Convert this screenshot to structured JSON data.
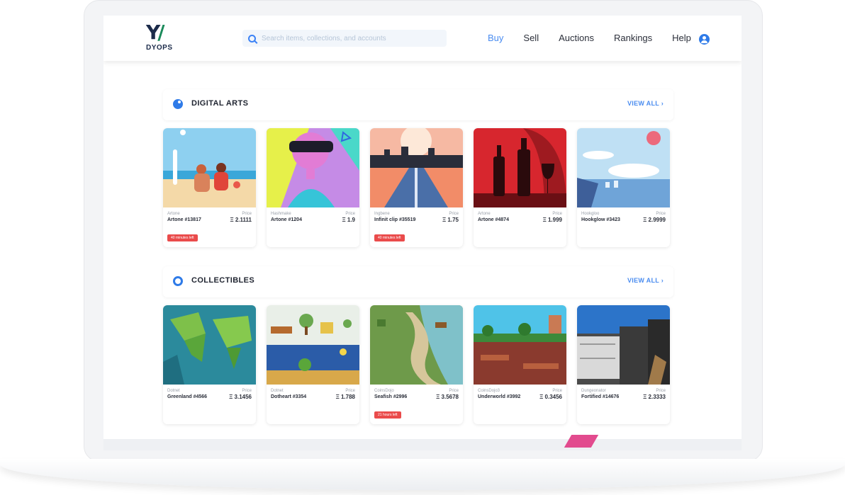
{
  "brand": {
    "name": "DYOPS",
    "mark": "Y"
  },
  "search": {
    "placeholder": "Search items, collections, and accounts"
  },
  "nav": {
    "items": [
      "Buy",
      "Sell",
      "Auctions",
      "Rankings",
      "Help"
    ],
    "active": "Buy"
  },
  "icons": {
    "search": "search-icon",
    "account": "account-icon",
    "digital_arts": "palette-icon",
    "collectibles": "globe-icon",
    "chevron": "chevron-right-icon"
  },
  "colors": {
    "accent": "#4a8cf0",
    "badge": "#ea4b4b",
    "brand": "#1c2b4a"
  },
  "sections": [
    {
      "title": "DIGITAL ARTS",
      "view_all": "VIEW ALL ›",
      "cards": [
        {
          "collection": "Artone",
          "name": "Artone #13817",
          "price_label": "Price",
          "price": "Ξ 2.1111",
          "badge": "40 minutes left"
        },
        {
          "collection": "Hashmake",
          "name": "Artone #1204",
          "price_label": "Price",
          "price": "Ξ 1.9"
        },
        {
          "collection": "Ingbene",
          "name": "Infinit clip #35519",
          "price_label": "Price",
          "price": "Ξ 1.75",
          "badge": "40 minutes left"
        },
        {
          "collection": "Artone",
          "name": "Artone #4874",
          "price_label": "Price",
          "price": "Ξ 1.999"
        },
        {
          "collection": "Hookgloo",
          "name": "Hookglow #3423",
          "price_label": "Price",
          "price": "Ξ 2.9999"
        }
      ]
    },
    {
      "title": "COLLECTIBLES",
      "view_all": "VIEW ALL ›",
      "cards": [
        {
          "collection": "Dotnet",
          "name": "Greenland #4566",
          "price_label": "Price",
          "price": "Ξ 3.1456"
        },
        {
          "collection": "Dotnet",
          "name": "Dotheart #3354",
          "price_label": "Price",
          "price": "Ξ 1.788"
        },
        {
          "collection": "CoinsDojo",
          "name": "Seafish #2996",
          "price_label": "Price",
          "price": "Ξ 3.5678",
          "badge": "21 hours left"
        },
        {
          "collection": "CoinsDojo3",
          "name": "Underworld #3992",
          "price_label": "Price",
          "price": "Ξ 0.3456"
        },
        {
          "collection": "Dungeonator",
          "name": "Fortified #14676",
          "price_label": "Price",
          "price": "Ξ 2.3333"
        }
      ]
    }
  ]
}
